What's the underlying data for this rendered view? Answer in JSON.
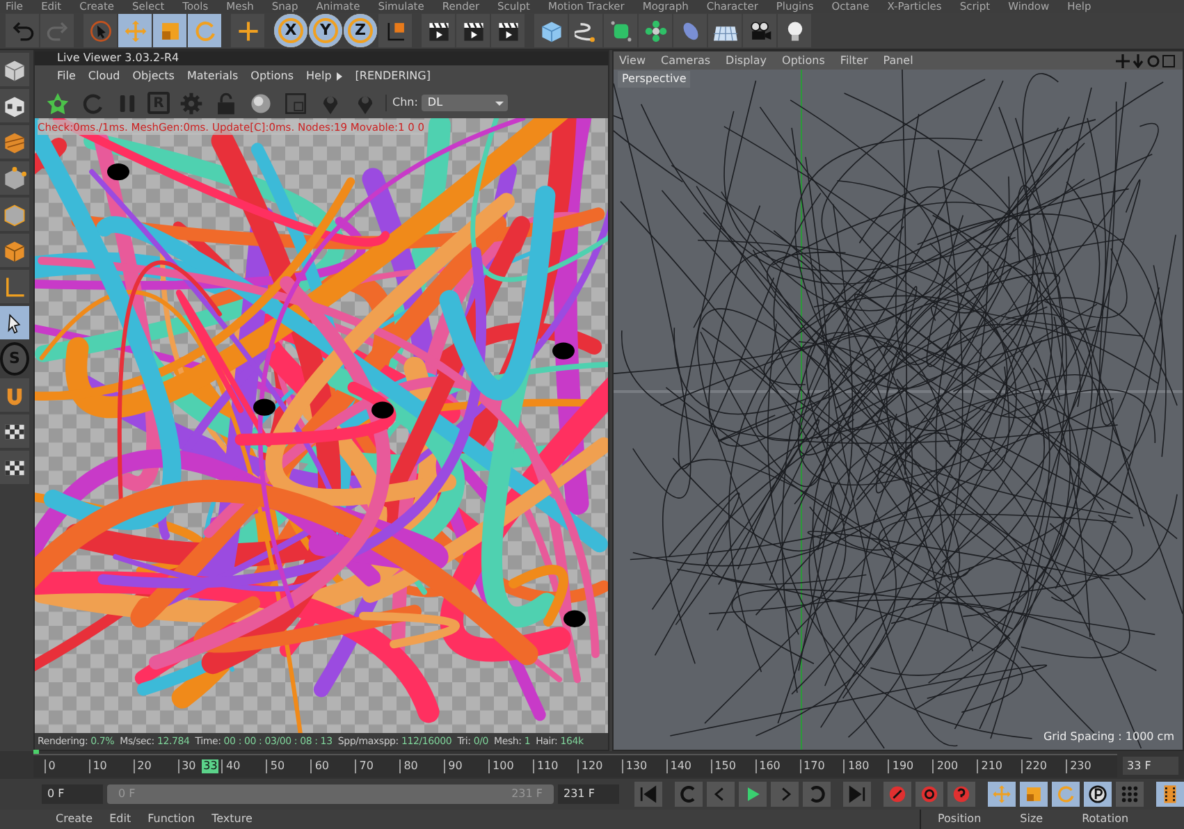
{
  "menu_bar": [
    "File",
    "Edit",
    "Create",
    "Select",
    "Tools",
    "Mesh",
    "Snap",
    "Animate",
    "Simulate",
    "Render",
    "Sculpt",
    "Motion Tracker",
    "Mograph",
    "Character",
    "Plugins",
    "Octane",
    "X-Particles",
    "Script",
    "Window",
    "Help"
  ],
  "toolbar": [
    {
      "kind": "undo",
      "selected": false
    },
    {
      "kind": "redo",
      "selected": false
    },
    {
      "kind": "select",
      "selected": false
    },
    {
      "kind": "move",
      "selected": true
    },
    {
      "kind": "scale",
      "selected": true
    },
    {
      "kind": "rotate",
      "selected": true
    },
    {
      "kind": "add",
      "selected": false
    },
    {
      "kind": "axis",
      "label": "X",
      "selected": true
    },
    {
      "kind": "axis",
      "label": "Y",
      "selected": true
    },
    {
      "kind": "axis",
      "label": "Z",
      "selected": true
    },
    {
      "kind": "coord",
      "selected": false
    },
    {
      "kind": "clapper",
      "selected": false
    },
    {
      "kind": "clapper",
      "selected": false
    },
    {
      "kind": "clapper",
      "selected": false
    },
    {
      "kind": "cube",
      "selected": false
    },
    {
      "kind": "pen",
      "selected": false
    },
    {
      "kind": "subdiv",
      "selected": false
    },
    {
      "kind": "cloner",
      "selected": false
    },
    {
      "kind": "deformer",
      "selected": false
    },
    {
      "kind": "floor",
      "selected": false
    },
    {
      "kind": "camera",
      "selected": false
    },
    {
      "kind": "light",
      "selected": false
    }
  ],
  "left_toolbar": [
    {
      "kind": "model",
      "selected": false
    },
    {
      "kind": "texture",
      "selected": false
    },
    {
      "kind": "workplane",
      "selected": false
    },
    {
      "kind": "points",
      "selected": false
    },
    {
      "kind": "edges",
      "selected": false
    },
    {
      "kind": "polygons",
      "selected": false
    },
    {
      "kind": "axis",
      "selected": false
    },
    {
      "kind": "tweak",
      "selected": true
    },
    {
      "kind": "snap",
      "label": "S",
      "selected": false
    },
    {
      "kind": "magnet",
      "selected": false
    },
    {
      "kind": "grid",
      "selected": false
    },
    {
      "kind": "grid",
      "selected": false
    }
  ],
  "live_viewer": {
    "title": "Live Viewer 3.03.2-R4",
    "menu": [
      "File",
      "Cloud",
      "Objects",
      "Materials",
      "Options",
      "Help"
    ],
    "status_tag": "[RENDERING]",
    "tools": [
      {
        "kind": "start"
      },
      {
        "kind": "restart"
      },
      {
        "kind": "pause"
      },
      {
        "kind": "letter",
        "label": "R"
      },
      {
        "kind": "gear"
      },
      {
        "kind": "lock"
      },
      {
        "kind": "sphere"
      },
      {
        "kind": "region"
      },
      {
        "kind": "pin"
      },
      {
        "kind": "pin"
      }
    ],
    "channel_label": "Chn:",
    "channel_value": "DL",
    "overlay_info": "Check:0ms./1ms. MeshGen:0ms. Update[C]:0ms. Nodes:19 Movable:1  0 0",
    "stats": [
      {
        "label": "Rendering:",
        "value": "0.7%"
      },
      {
        "label": "Ms/sec:",
        "value": "12.784"
      },
      {
        "label": "Time:",
        "value": "00 : 00 : 03/00 : 08 : 13"
      },
      {
        "label": "Spp/maxspp:",
        "value": "112/16000"
      },
      {
        "label": "Tri:",
        "value": "0/0"
      },
      {
        "label": "Mesh:",
        "value": "1"
      },
      {
        "label": "Hair:",
        "value": "164k"
      }
    ],
    "progress": {
      "level": 0.007
    }
  },
  "viewport": {
    "menu": [
      "View",
      "Cameras",
      "Display",
      "Options",
      "Filter",
      "Panel"
    ],
    "camera_label": "Perspective",
    "grid_label": "Grid Spacing : 1000 cm"
  },
  "timeline": {
    "ticks": [
      "0",
      "10",
      "20",
      "30",
      "40",
      "50",
      "60",
      "70",
      "80",
      "90",
      "100",
      "110",
      "120",
      "130",
      "140",
      "150",
      "160",
      "170",
      "180",
      "190",
      "200",
      "210",
      "220",
      "230"
    ],
    "current": "33",
    "level": 0.1375,
    "frame_field": "33 F"
  },
  "transport": {
    "range": {
      "level": 1
    },
    "start_field": "0 F",
    "range_start": "0 F",
    "range_end": "231 F",
    "end_field": "231 F"
  },
  "materials_menu": [
    "Create",
    "Edit",
    "Function",
    "Texture"
  ],
  "coordinates_headers": [
    "Position",
    "Size",
    "Rotation"
  ]
}
